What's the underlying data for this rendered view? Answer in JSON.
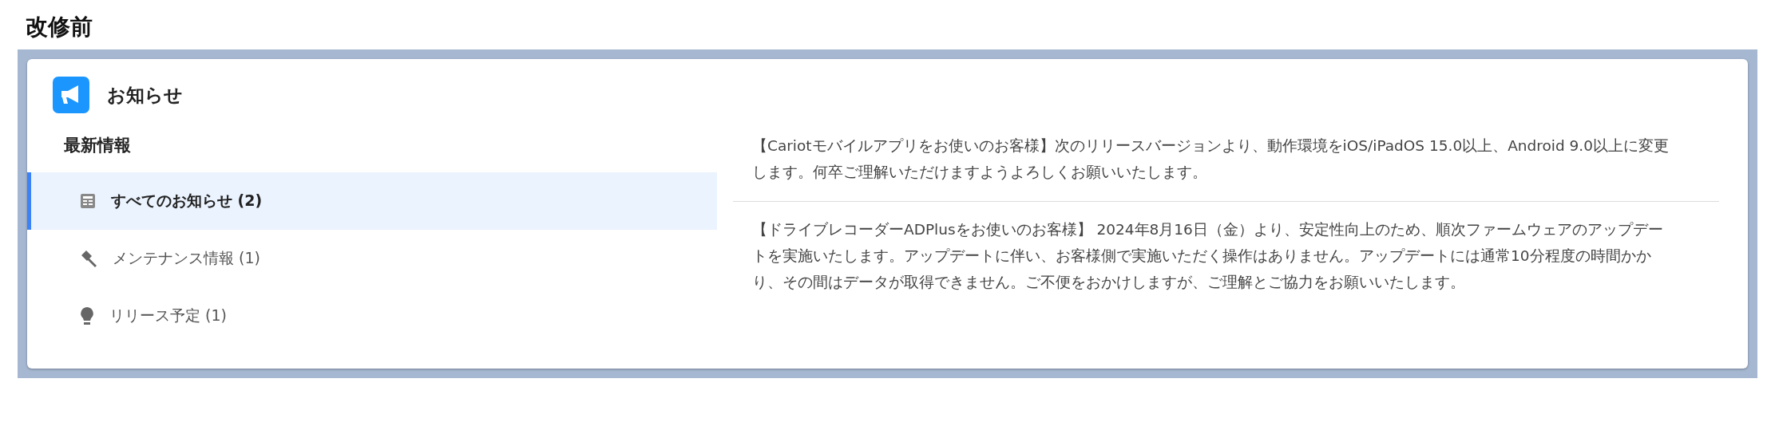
{
  "heading": "改修前",
  "card": {
    "title": "お知らせ",
    "sidebar": {
      "heading": "最新情報",
      "items": [
        {
          "kind": "list",
          "label": "すべてのお知らせ (2)",
          "selected": true
        },
        {
          "kind": "gavel",
          "label": "メンテナンス情報 (1)",
          "selected": false
        },
        {
          "kind": "bulb",
          "label": "リリース予定 (1)",
          "selected": false
        }
      ]
    },
    "messages": [
      "【Cariotモバイルアプリをお使いのお客様】次のリリースバージョンより、動作環境をiOS/iPadOS 15.0以上、Android 9.0以上に変更します。何卒ご理解いただけますようよろしくお願いいたします。",
      "【ドライブレコーダーADPlusをお使いのお客様】 2024年8月16日（金）より、安定性向上のため、順次ファームウェアのアップデートを実施いたします。アップデートに伴い、お客様側で実施いただく操作はありません。アップデートには通常10分程度の時間かかり、その間はデータが取得できません。ご不便をおかけしますが、ご理解とご協力をお願いいたします。"
    ]
  }
}
